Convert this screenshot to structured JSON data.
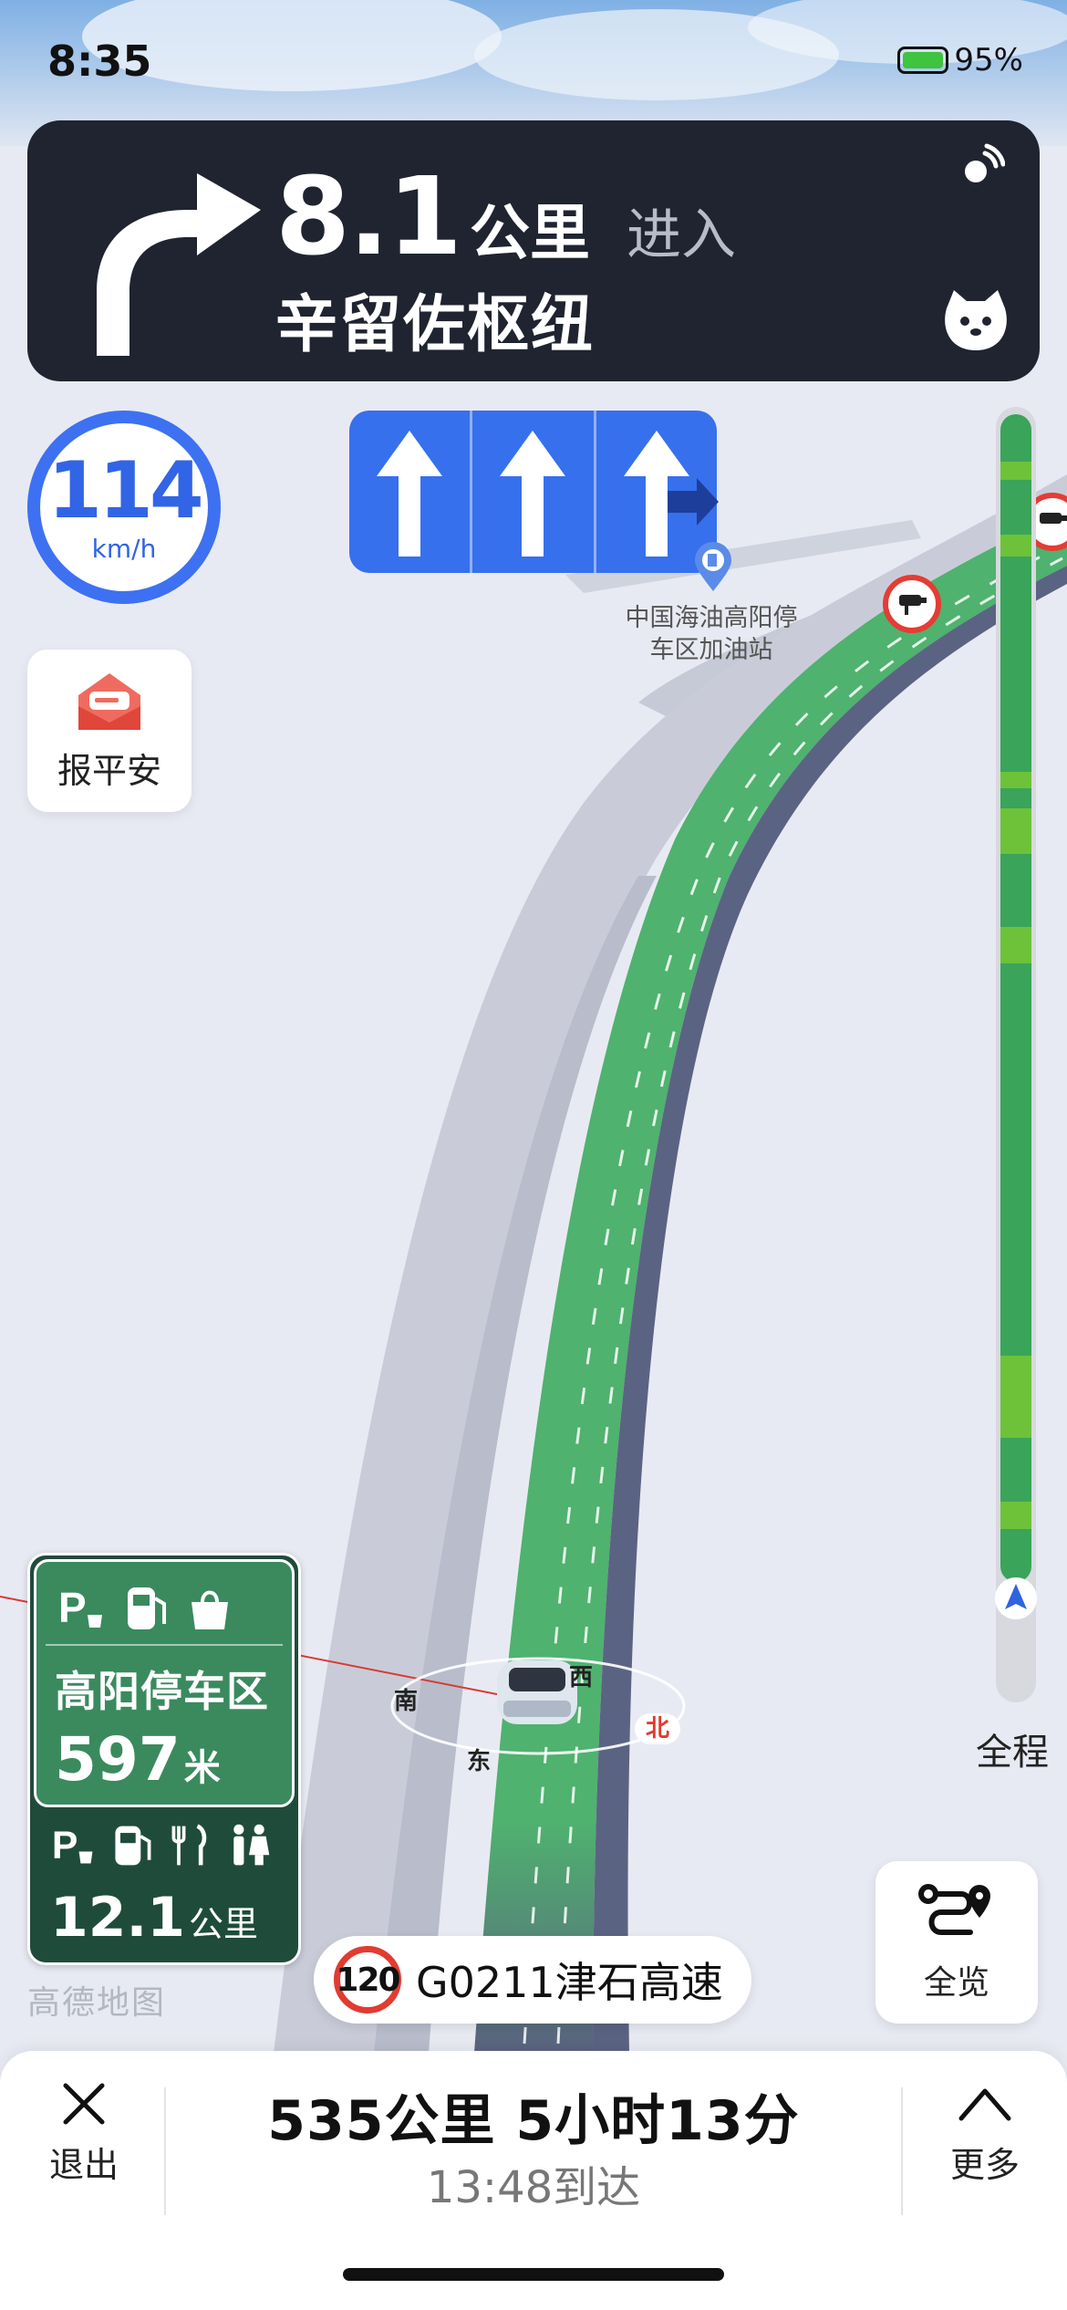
{
  "status": {
    "time": "8:35",
    "battery": "95%"
  },
  "navigation": {
    "distance_value": "8.1",
    "distance_unit": "公里",
    "action": "进入",
    "road_name": "辛留佐枢纽"
  },
  "speed": {
    "value": "114",
    "unit": "km/h"
  },
  "report_button": {
    "label": "报平安"
  },
  "lanes": [
    {
      "direction": "straight",
      "highlighted": true
    },
    {
      "direction": "straight",
      "highlighted": true
    },
    {
      "direction": "straight-right",
      "highlighted": true
    }
  ],
  "poi": {
    "name": "中国海油高阳停车区加油站"
  },
  "compass": {
    "south": "南",
    "west": "西",
    "north": "北",
    "east": "东"
  },
  "progress": {
    "label": "全程"
  },
  "service_area": {
    "name": "高阳停车区",
    "distance_value": "597",
    "distance_unit": "米",
    "next_distance_value": "12.1",
    "next_distance_unit": "公里"
  },
  "watermark": "高德地图",
  "current_road": {
    "speed_limit": "120",
    "name": "G0211津石高速"
  },
  "overview_button": {
    "label": "全览"
  },
  "trip": {
    "summary": "535公里 5小时13分",
    "arrival": "13:48到达"
  },
  "exit_button": {
    "label": "退出"
  },
  "more_button": {
    "label": "更多"
  },
  "colors": {
    "route_green": "#4fb26f",
    "lane_blue": "#3670ed",
    "nav_card": "#1f2430",
    "speed_blue": "#3d71f2",
    "alert_red": "#e53c34"
  }
}
